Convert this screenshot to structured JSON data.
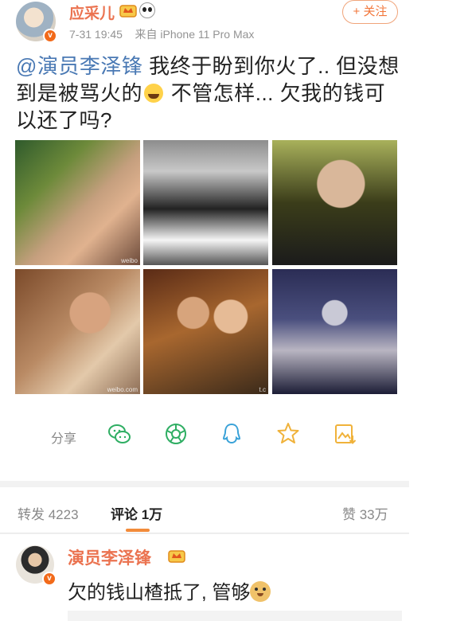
{
  "post": {
    "username": "应采儿",
    "time": "7-31 19:45",
    "source": "来自 iPhone 11 Pro Max",
    "follow_label": "+ 关注",
    "mention": "@演员李泽锋",
    "text_part1": " 我终于盼到你火了.. 但没想到是被骂火的",
    "text_part2": " 不管怎样... 欠我的钱可以还了吗?",
    "verified_badge": "v"
  },
  "images": [
    {
      "watermark": "weibo"
    },
    {
      "watermark": ""
    },
    {
      "watermark": ""
    },
    {
      "watermark": "weibo.com"
    },
    {
      "watermark": "t.c"
    },
    {
      "watermark": ""
    }
  ],
  "share": {
    "label": "分享",
    "icons": [
      "wechat-icon",
      "moments-icon",
      "qq-icon",
      "qzone-icon",
      "save-image-icon"
    ]
  },
  "tabs": {
    "repost": "转发 4223",
    "comment": "评论 1万",
    "like": "赞 33万"
  },
  "comment": {
    "username": "演员李泽锋",
    "text": "欠的钱山楂抵了, 管够"
  },
  "colors": {
    "accent_orange": "#eb7350",
    "mention_blue": "#4a79b4",
    "share_green": "#2fae63",
    "share_blue": "#3aa2d8",
    "share_yellow": "#f0b23a"
  }
}
